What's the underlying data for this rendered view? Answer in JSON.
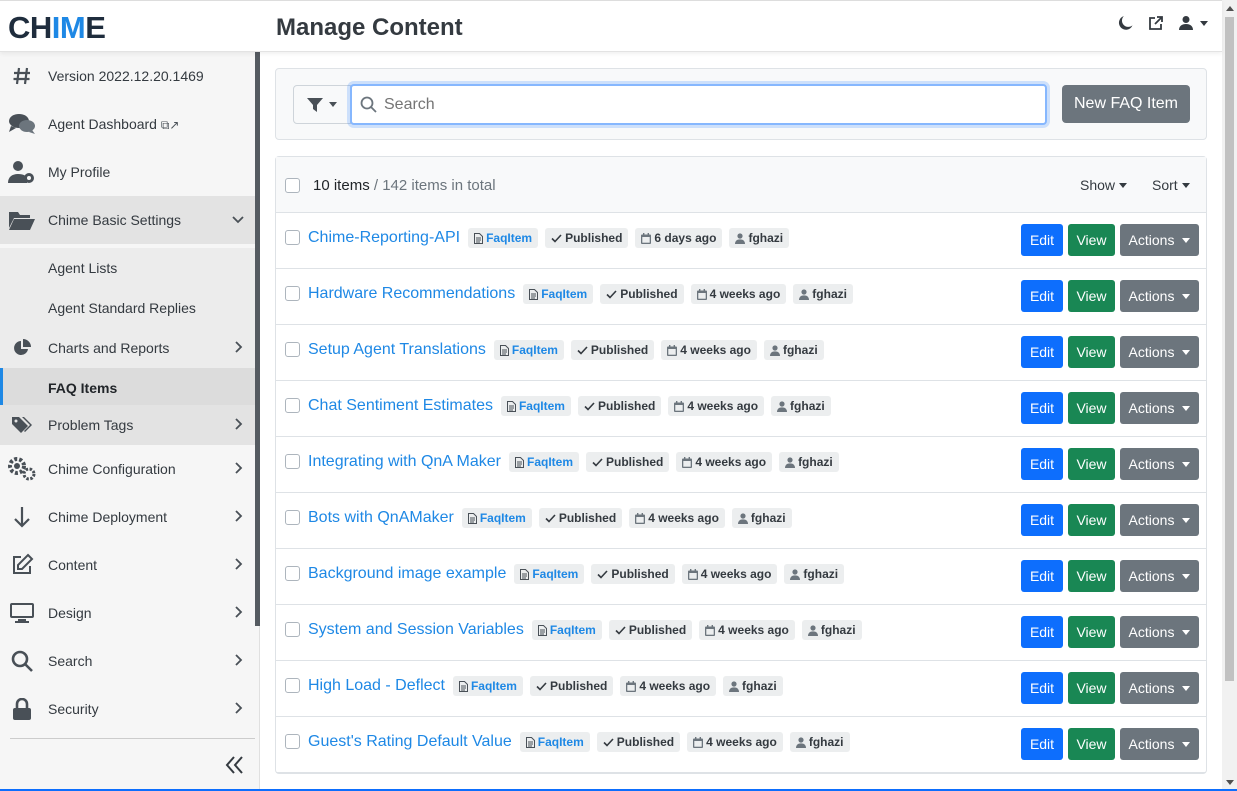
{
  "app": {
    "logo_prefix": "CH",
    "logo_accent": "IM",
    "logo_suffix": "E",
    "page_title": "Manage Content"
  },
  "header_icons": [
    "moon-icon",
    "external-link-icon",
    "user-icon",
    "caret-down-icon"
  ],
  "sidebar": {
    "items": [
      {
        "label": "Version 2022.12.20.1469",
        "icon": "hash-icon"
      },
      {
        "label": "Agent Dashboard",
        "icon": "chat-icon",
        "suffix_icon": "open-window-icon"
      },
      {
        "label": "My Profile",
        "icon": "user-gear-icon"
      },
      {
        "label": "Chime Basic Settings",
        "icon": "folder-open-icon",
        "expanded": true
      },
      {
        "label": "Agent Lists"
      },
      {
        "label": "Agent Standard Replies"
      },
      {
        "label": "Charts and Reports",
        "icon": "pie-chart-icon"
      },
      {
        "label": "FAQ Items",
        "active": true
      },
      {
        "label": "Problem Tags",
        "icon": "tags-icon"
      },
      {
        "label": "Chime Configuration",
        "icon": "cogs-icon"
      },
      {
        "label": "Chime Deployment",
        "icon": "arrow-down-icon"
      },
      {
        "label": "Content",
        "icon": "edit-icon"
      },
      {
        "label": "Design",
        "icon": "monitor-icon"
      },
      {
        "label": "Search",
        "icon": "search-icon"
      },
      {
        "label": "Security",
        "icon": "lock-icon"
      }
    ]
  },
  "toolbar": {
    "search_placeholder": "Search",
    "new_button": "New FAQ Item"
  },
  "list": {
    "count_label": "10 items",
    "total_label": " / 142 items in total",
    "show_label": "Show",
    "sort_label": "Sort",
    "buttons": {
      "edit": "Edit",
      "view": "View",
      "actions": "Actions"
    },
    "rows": [
      {
        "title": "Chime-Reporting-API",
        "type": "FaqItem",
        "status": "Published",
        "date": "6 days ago",
        "author": "fghazi"
      },
      {
        "title": "Hardware Recommendations",
        "type": "FaqItem",
        "status": "Published",
        "date": "4 weeks ago",
        "author": "fghazi"
      },
      {
        "title": "Setup Agent Translations",
        "type": "FaqItem",
        "status": "Published",
        "date": "4 weeks ago",
        "author": "fghazi"
      },
      {
        "title": "Chat Sentiment Estimates",
        "type": "FaqItem",
        "status": "Published",
        "date": "4 weeks ago",
        "author": "fghazi"
      },
      {
        "title": "Integrating with QnA Maker",
        "type": "FaqItem",
        "status": "Published",
        "date": "4 weeks ago",
        "author": "fghazi"
      },
      {
        "title": "Bots with QnAMaker",
        "type": "FaqItem",
        "status": "Published",
        "date": "4 weeks ago",
        "author": "fghazi"
      },
      {
        "title": "Background image example",
        "type": "FaqItem",
        "status": "Published",
        "date": "4 weeks ago",
        "author": "fghazi"
      },
      {
        "title": "System and Session Variables",
        "type": "FaqItem",
        "status": "Published",
        "date": "4 weeks ago",
        "author": "fghazi"
      },
      {
        "title": "High Load - Deflect",
        "type": "FaqItem",
        "status": "Published",
        "date": "4 weeks ago",
        "author": "fghazi"
      },
      {
        "title": "Guest's Rating Default Value",
        "type": "FaqItem",
        "status": "Published",
        "date": "4 weeks ago",
        "author": "fghazi"
      }
    ]
  },
  "colors": {
    "accent": "#1e88e5",
    "edit": "#0d6efd",
    "view": "#198754",
    "actions": "#6c757d"
  }
}
